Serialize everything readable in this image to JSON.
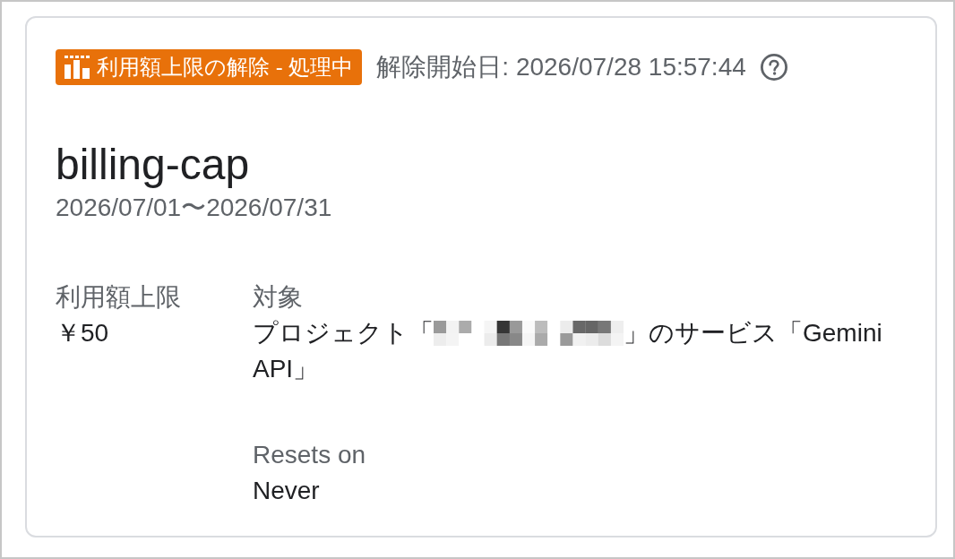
{
  "status_badge": "利用額上限の解除 - 処理中",
  "release_start": "解除開始日: 2026/07/28 15:57:44",
  "title": "billing-cap",
  "period": "2026/07/01〜2026/07/31",
  "limit": {
    "label": "利用額上限",
    "value": "￥50"
  },
  "fields": [
    {
      "kind": "target",
      "label": "対象",
      "prefix": "プロジェクト「",
      "redacted": true,
      "suffix": "」のサービス「Gemini API」"
    },
    {
      "kind": "text",
      "label": "Resets on",
      "value": "Never"
    }
  ]
}
